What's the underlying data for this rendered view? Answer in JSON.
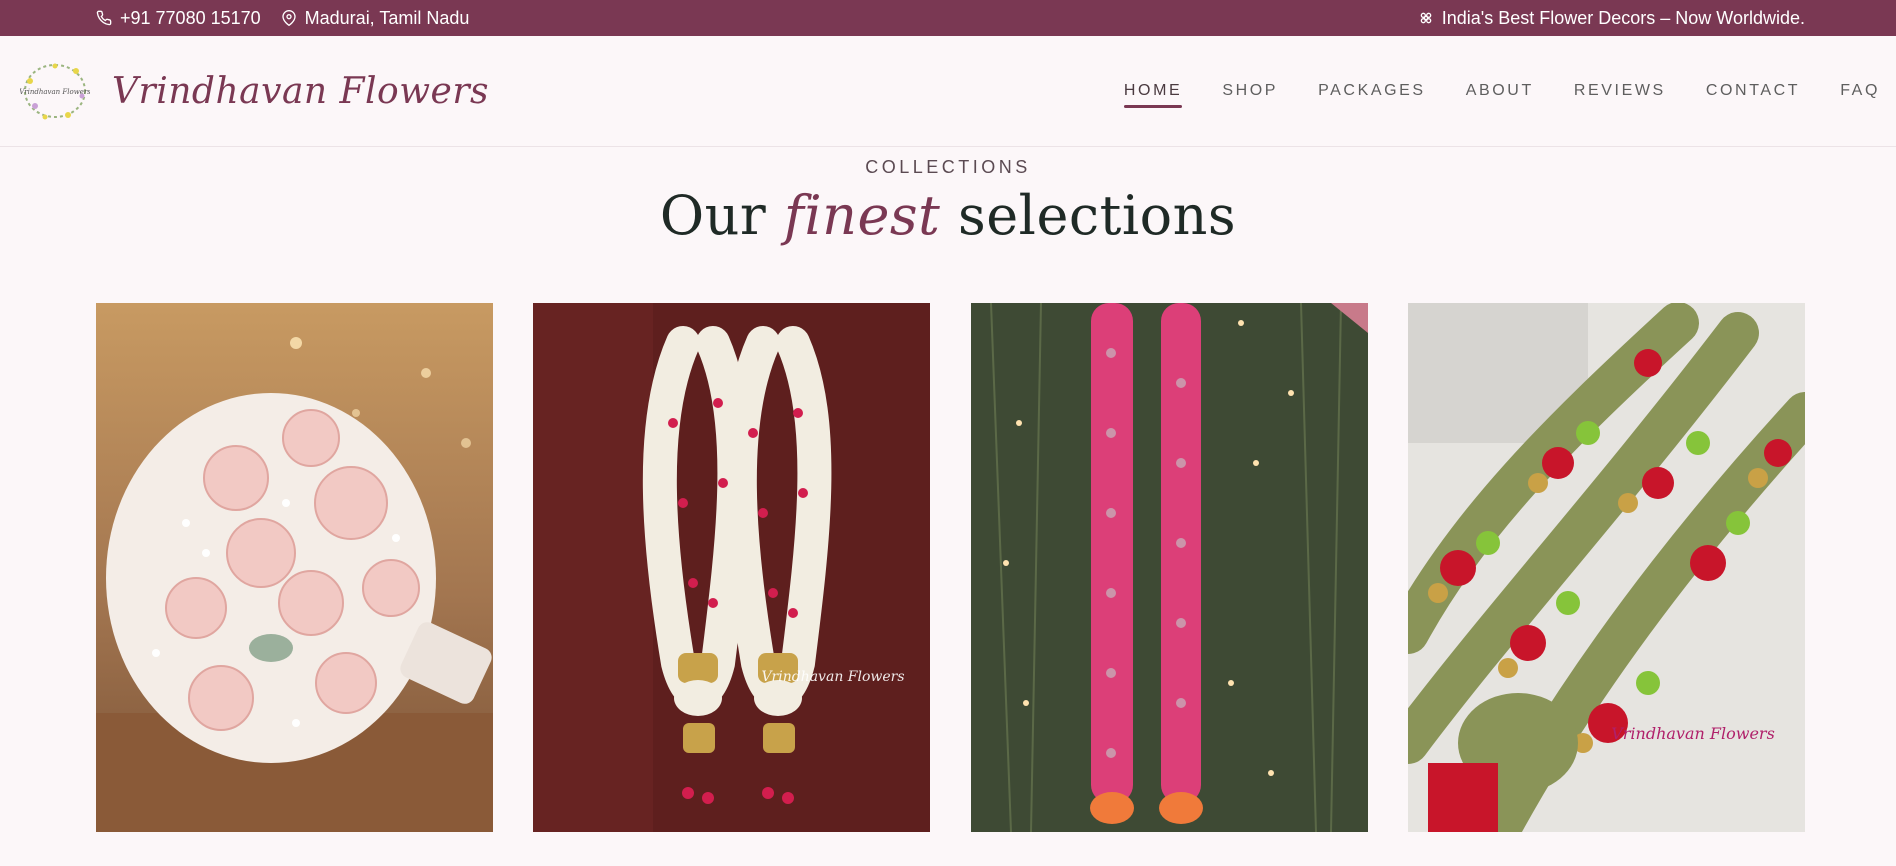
{
  "topbar": {
    "phone": "+91 77080 15170",
    "location": "Madurai, Tamil Nadu",
    "tagline": "India's Best Flower Decors – Now Worldwide."
  },
  "header": {
    "brand": "Vrindhavan Flowers",
    "logo_text": "Vrindhavan Flowers"
  },
  "nav": [
    {
      "label": "HOME",
      "active": true
    },
    {
      "label": "SHOP"
    },
    {
      "label": "PACKAGES"
    },
    {
      "label": "ABOUT"
    },
    {
      "label": "REVIEWS"
    },
    {
      "label": "CONTACT"
    },
    {
      "label": "FAQ"
    }
  ],
  "section": {
    "eyebrow": "COLLECTIONS",
    "title_pre": "Our",
    "title_em": "finest",
    "title_post": "selections"
  },
  "products": [
    {
      "image": "rose-bouquet-photo"
    },
    {
      "image": "jasmine-garland-photo",
      "watermark": "Vrindhavan Flowers"
    },
    {
      "image": "pink-rose-garland-photo"
    },
    {
      "image": "green-red-garland-photo",
      "watermark": "Vrindhavan Flowers"
    }
  ],
  "colors": {
    "accent": "#7a3853",
    "background": "#fcf7f9",
    "title": "#1f2a26"
  }
}
